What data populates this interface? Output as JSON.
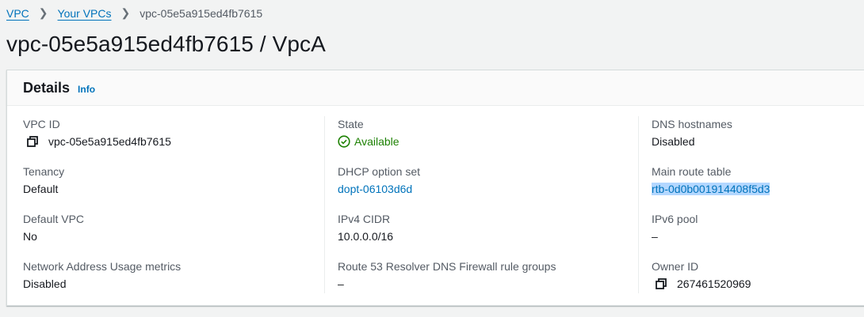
{
  "breadcrumb": [
    {
      "label": "VPC"
    },
    {
      "label": "Your VPCs"
    },
    {
      "label": "vpc-05e5a915ed4fb7615"
    }
  ],
  "page_title": "vpc-05e5a915ed4fb7615 / VpcA",
  "panel": {
    "title": "Details",
    "info": "Info"
  },
  "columns": [
    [
      {
        "label": "VPC ID",
        "value": "vpc-05e5a915ed4fb7615",
        "icon": "copy-icon"
      },
      {
        "label": "Tenancy",
        "value": "Default"
      },
      {
        "label": "Default VPC",
        "value": "No"
      },
      {
        "label": "Network Address Usage metrics",
        "value": "Disabled"
      }
    ],
    [
      {
        "label": "State",
        "value": "Available",
        "icon": "check-circle-icon"
      },
      {
        "label": "DHCP option set",
        "value": "dopt-06103d6d"
      },
      {
        "label": "IPv4 CIDR",
        "value": "10.0.0.0/16"
      },
      {
        "label": "Route 53 Resolver DNS Firewall rule groups",
        "value": "–"
      }
    ],
    [
      {
        "label": "DNS hostnames",
        "value": "Disabled"
      },
      {
        "label": "Main route table",
        "value": "rtb-0d0b001914408f5d3"
      },
      {
        "label": "IPv6 pool",
        "value": "–"
      },
      {
        "label": "Owner ID",
        "value": "267461520969",
        "icon": "copy-icon"
      }
    ]
  ],
  "colors": {
    "link": "#0073bb",
    "success": "#1d8102",
    "selection": "#b3d7ff"
  }
}
